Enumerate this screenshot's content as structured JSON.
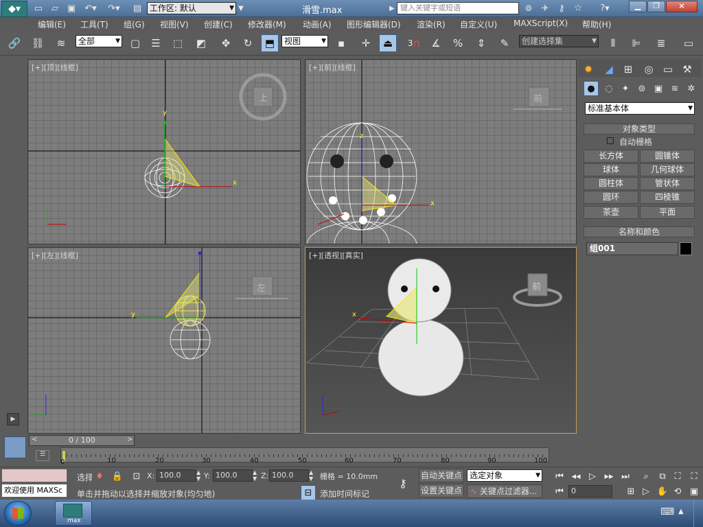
{
  "titlebar": {
    "workspace_label": "工作区: 默认",
    "file_title": "滑雪.max",
    "search_placeholder": "键入关键字或短语"
  },
  "menu": [
    "编辑(E)",
    "工具(T)",
    "组(G)",
    "视图(V)",
    "创建(C)",
    "修改器(M)",
    "动画(A)",
    "图形编辑器(D)",
    "渲染(R)",
    "自定义(U)",
    "MAXScript(X)",
    "帮助(H)"
  ],
  "toolbar": {
    "filter_value": "全部",
    "refcoord_value": "视图",
    "selset_value": "创建选择集",
    "snap_num": "3",
    "percent": "%"
  },
  "viewports": {
    "top": {
      "label": "[+][顶][线框]",
      "cube": "上"
    },
    "front": {
      "label": "[+][前][线框]",
      "cube": "前"
    },
    "left": {
      "label": "[+][左][线框]",
      "cube": "左"
    },
    "persp": {
      "label": "[+][透视][真实]",
      "cube": "前"
    }
  },
  "axes": {
    "x": "x",
    "y": "y",
    "z": "z"
  },
  "panel": {
    "category_value": "标准基本体",
    "object_type_header": "对象类型",
    "autogrid_label": "自动栅格",
    "buttons": [
      "长方体",
      "圆锥体",
      "球体",
      "几何球体",
      "圆柱体",
      "管状体",
      "圆环",
      "四棱锥",
      "茶壶",
      "平面"
    ],
    "name_color_header": "名称和颜色",
    "object_name": "组001",
    "object_color": "#000000"
  },
  "timeline": {
    "frame_display": "0 / 100",
    "ticks": [
      "10",
      "20",
      "30",
      "40",
      "50",
      "60",
      "70",
      "80",
      "90",
      "100"
    ],
    "start_tick": "0"
  },
  "status": {
    "welcome": "欢迎使用 MAXSc",
    "select_label": "选择",
    "x_label": "X:",
    "x_value": "100.0",
    "y_label": "Y:",
    "y_value": "100.0",
    "z_label": "Z:",
    "z_value": "100.0",
    "grid_value": "栅格 = 10.0mm",
    "prompt": "单击并拖动以选择并缩放对象(均匀地)",
    "add_time_tag": "添加时间标记",
    "auto_key": "自动关键点",
    "set_key": "设置关键点",
    "selected_object": "选定对象",
    "key_filters": "关键点过滤器...",
    "current_frame": "0"
  },
  "taskbar": {
    "app_label": "max"
  }
}
